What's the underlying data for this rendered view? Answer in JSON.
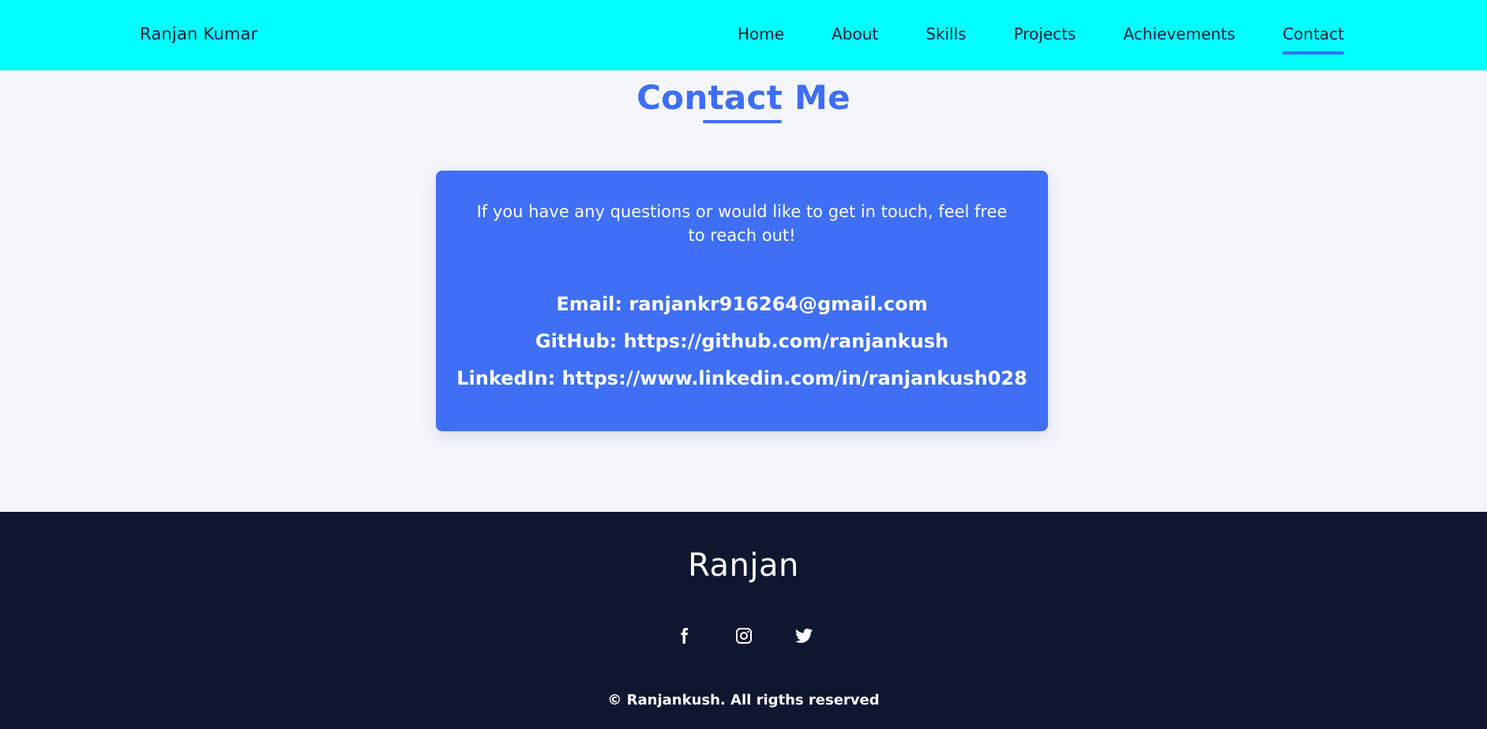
{
  "navbar": {
    "brand": "Ranjan Kumar",
    "links": [
      {
        "label": "Home"
      },
      {
        "label": "About"
      },
      {
        "label": "Skills"
      },
      {
        "label": "Projects"
      },
      {
        "label": "Achievements"
      },
      {
        "label": "Contact",
        "active": true
      }
    ],
    "background_color": "#00ffff",
    "active_underline_color": "#3d6ef5"
  },
  "contact": {
    "title": "Contact Me",
    "intro": "If you have any questions or would like to get in touch, feel free to reach out!",
    "email_label": "Email:",
    "email_value": "ranjankr916264@gmail.com",
    "github_label": "GitHub:",
    "github_value": "https://github.com/ranjankush",
    "linkedin_label": "LinkedIn:",
    "linkedin_value": "https://www.linkedin.com/in/ranjankush028",
    "accent_color": "#3d6ef5",
    "card_color": "#3f6ff4"
  },
  "footer": {
    "name": "Ranjan",
    "socials": [
      {
        "icon": "facebook-icon"
      },
      {
        "icon": "instagram-icon"
      },
      {
        "icon": "twitter-icon"
      }
    ],
    "copyright": "© Ranjankush. All rigths reserved",
    "background_color": "#0f1730"
  }
}
